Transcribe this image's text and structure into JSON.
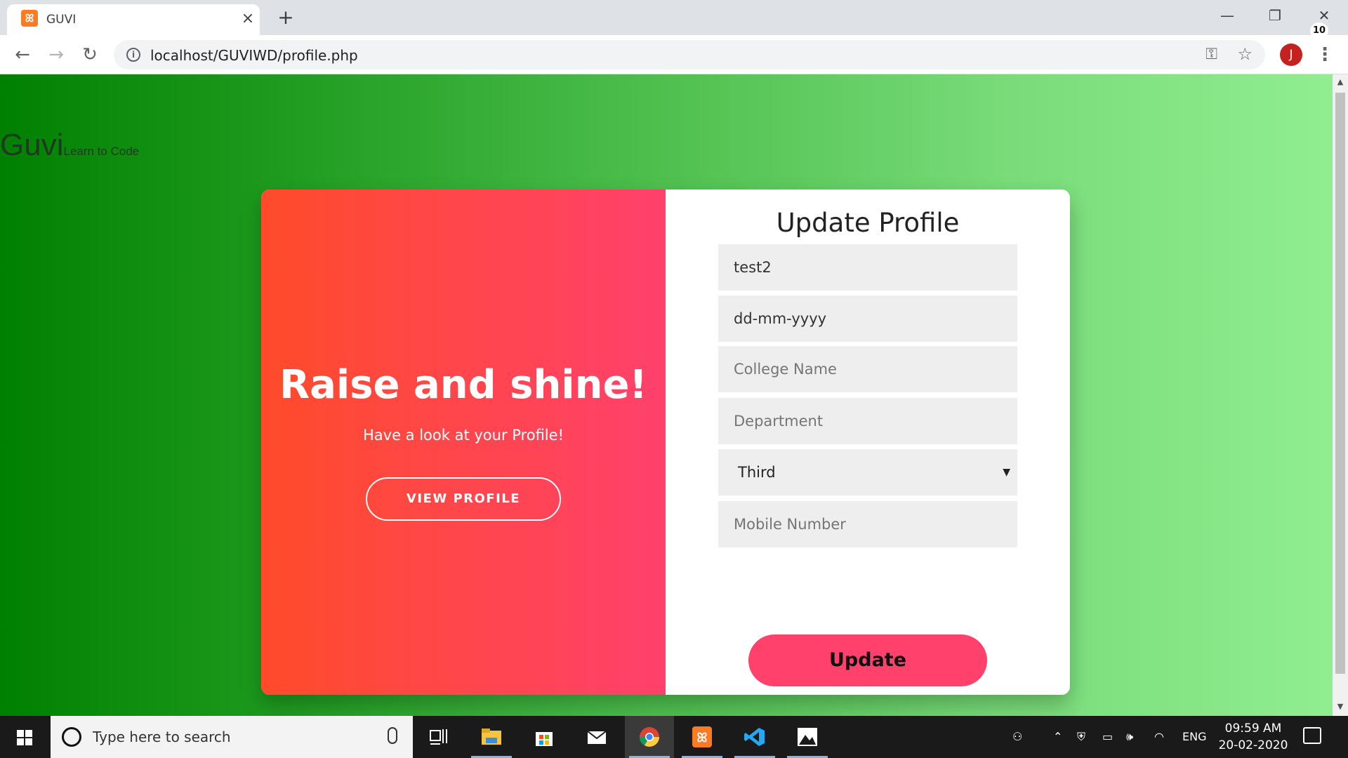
{
  "browser": {
    "tab_title": "GUVI",
    "tab_favicon_label": "ꕤ",
    "new_tab_label": "+",
    "url": "localhost/GUVIWD/profile.php",
    "avatar_letter": "J"
  },
  "page": {
    "brand_name": "Guvi",
    "brand_tagline": "Learn to Code",
    "left_heading": "Raise and shine!",
    "left_subtext": "Have a look at your Profile!",
    "view_profile_label": "VIEW PROFILE",
    "form_title": "Update Profile",
    "fields": {
      "username_value": "test2",
      "dob_value": "dd-mm-yyyy",
      "college_placeholder": "College Name",
      "department_placeholder": "Department",
      "year_selected": "Third",
      "mobile_placeholder": "Mobile Number"
    },
    "update_label": "Update",
    "colors": {
      "gradient_left": "#ff4b2b",
      "gradient_right": "#ff416c",
      "update_button": "#ff416c",
      "bg_green_dark": "#008000",
      "bg_green_light": "#90ee90"
    }
  },
  "taskbar": {
    "search_placeholder": "Type here to search",
    "language": "ENG",
    "time": "09:59 AM",
    "date": "20-02-2020",
    "notification_count": "10"
  }
}
